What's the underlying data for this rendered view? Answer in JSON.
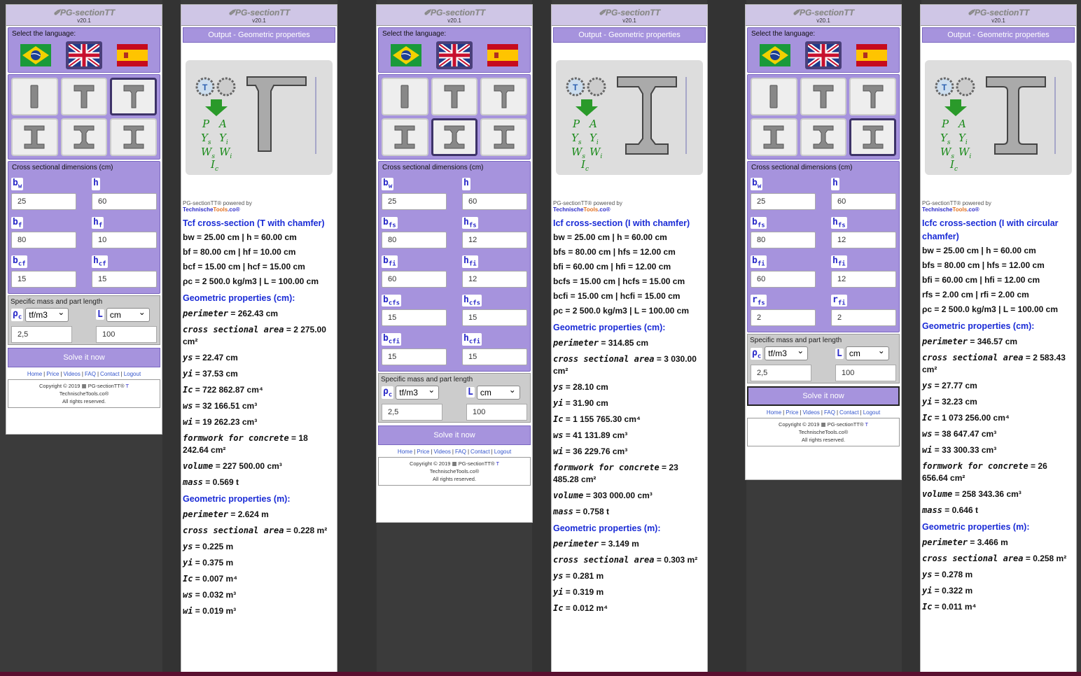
{
  "app": {
    "title": "PG-sectionTT",
    "version": "v20.1"
  },
  "ui": {
    "select_language": "Select the language:",
    "output_title": "Output - Geometric properties",
    "cross_dims": "Cross sectional dimensions (cm)",
    "mass_title": "Specific mass and part length",
    "solve": "Solve it now",
    "rho_unit": "tf/m3",
    "len_unit": "cm",
    "rho_val": "2,5",
    "len_val": "100",
    "links": [
      "Home",
      "Price",
      "Videos",
      "FAQ",
      "Contact",
      "Logout"
    ],
    "copy1": "Copyright © 2019",
    "copy_brand": "PG-sectionTT®",
    "copy2": "TechnischeTools.co®",
    "copy3": "All rights reserved.",
    "powered": "powered by",
    "pg_brand": "PG-sectionTT®",
    "tt_a": "Technische",
    "tt_b": "Tools",
    "tt_c": ".co®"
  },
  "input1": {
    "fields": [
      {
        "sym": "b",
        "sub": "w",
        "val": "25"
      },
      {
        "sym": "h",
        "sub": "",
        "val": "60"
      },
      {
        "sym": "b",
        "sub": "f",
        "val": "80"
      },
      {
        "sym": "h",
        "sub": "f",
        "val": "10"
      },
      {
        "sym": "b",
        "sub": "cf",
        "val": "15"
      },
      {
        "sym": "h",
        "sub": "cf",
        "val": "15"
      }
    ]
  },
  "input2": {
    "fields": [
      {
        "sym": "b",
        "sub": "w",
        "val": "25"
      },
      {
        "sym": "h",
        "sub": "",
        "val": "60"
      },
      {
        "sym": "b",
        "sub": "fs",
        "val": "80"
      },
      {
        "sym": "h",
        "sub": "fs",
        "val": "12"
      },
      {
        "sym": "b",
        "sub": "fi",
        "val": "60"
      },
      {
        "sym": "h",
        "sub": "fi",
        "val": "12"
      },
      {
        "sym": "b",
        "sub": "cfs",
        "val": "15"
      },
      {
        "sym": "h",
        "sub": "cfs",
        "val": "15"
      },
      {
        "sym": "b",
        "sub": "cfi",
        "val": "15"
      },
      {
        "sym": "h",
        "sub": "cfi",
        "val": "15"
      }
    ]
  },
  "input3": {
    "fields": [
      {
        "sym": "b",
        "sub": "w",
        "val": "25"
      },
      {
        "sym": "h",
        "sub": "",
        "val": "60"
      },
      {
        "sym": "b",
        "sub": "fs",
        "val": "80"
      },
      {
        "sym": "h",
        "sub": "fs",
        "val": "12"
      },
      {
        "sym": "b",
        "sub": "fi",
        "val": "60"
      },
      {
        "sym": "h",
        "sub": "fi",
        "val": "12"
      },
      {
        "sym": "r",
        "sub": "fs",
        "val": "2"
      },
      {
        "sym": "r",
        "sub": "fi",
        "val": "2"
      }
    ]
  },
  "out1": {
    "title": "Tcf cross-section (T with chamfer)",
    "lines_in": [
      "bw = 25.00 cm | h = 60.00 cm",
      "bf = 80.00 cm | hf = 10.00 cm",
      "bcf = 15.00 cm | hcf = 15.00 cm",
      "ρc = 2 500.0 kg/m3 | L = 100.00 cm"
    ],
    "cm_title": "Geometric properties (cm):",
    "cm": [
      [
        "perimeter",
        "262.43 cm"
      ],
      [
        "cross sectional area",
        "2 275.00 cm²"
      ],
      [
        "ys",
        "22.47 cm"
      ],
      [
        "yi",
        "37.53 cm"
      ],
      [
        "Ic",
        "722 862.87 cm⁴"
      ],
      [
        "ws",
        "32 166.51 cm³"
      ],
      [
        "wi",
        "19 262.23 cm³"
      ],
      [
        "formwork for concrete",
        "18 242.64 cm²"
      ],
      [
        "volume",
        "227 500.00 cm³"
      ],
      [
        "mass",
        "0.569 t"
      ]
    ],
    "m_title": "Geometric properties (m):",
    "m": [
      [
        "perimeter",
        "2.624 m"
      ],
      [
        "cross sectional area",
        "0.228 m²"
      ],
      [
        "ys",
        "0.225 m"
      ],
      [
        "yi",
        "0.375 m"
      ],
      [
        "Ic",
        "0.007 m⁴"
      ],
      [
        "ws",
        "0.032 m³"
      ],
      [
        "wi",
        "0.019 m³"
      ]
    ]
  },
  "out2": {
    "title": "Icf cross-section (I with chamfer)",
    "lines_in": [
      "bw = 25.00 cm | h = 60.00 cm",
      "bfs = 80.00 cm | hfs = 12.00 cm",
      "bfi = 60.00 cm | hfi = 12.00 cm",
      "bcfs = 15.00 cm | hcfs = 15.00 cm",
      "bcfi = 15.00 cm | hcfi = 15.00 cm",
      "ρc = 2 500.0 kg/m3 | L = 100.00 cm"
    ],
    "cm_title": "Geometric properties (cm):",
    "cm": [
      [
        "perimeter",
        "314.85 cm"
      ],
      [
        "cross sectional area",
        "3 030.00 cm²"
      ],
      [
        "ys",
        "28.10 cm"
      ],
      [
        "yi",
        "31.90 cm"
      ],
      [
        "Ic",
        "1 155 765.30 cm⁴"
      ],
      [
        "ws",
        "41 131.89 cm³"
      ],
      [
        "wi",
        "36 229.76 cm³"
      ],
      [
        "formwork for concrete",
        "23 485.28 cm²"
      ],
      [
        "volume",
        "303 000.00 cm³"
      ],
      [
        "mass",
        "0.758 t"
      ]
    ],
    "m_title": "Geometric properties (m):",
    "m": [
      [
        "perimeter",
        "3.149 m"
      ],
      [
        "cross sectional area",
        "0.303 m²"
      ],
      [
        "ys",
        "0.281 m"
      ],
      [
        "yi",
        "0.319 m"
      ],
      [
        "Ic",
        "0.012 m⁴"
      ]
    ]
  },
  "out3": {
    "title": "Icfc cross-section (I with circular chamfer)",
    "lines_in": [
      "bw = 25.00 cm | h = 60.00 cm",
      "bfs = 80.00 cm | hfs = 12.00 cm",
      "bfi = 60.00 cm | hfi = 12.00 cm",
      "rfs = 2.00 cm | rfi = 2.00 cm",
      "ρc = 2 500.0 kg/m3 | L = 100.00 cm"
    ],
    "cm_title": "Geometric properties (cm):",
    "cm": [
      [
        "perimeter",
        "346.57 cm"
      ],
      [
        "cross sectional area",
        "2 583.43 cm²"
      ],
      [
        "ys",
        "27.77 cm"
      ],
      [
        "yi",
        "32.23 cm"
      ],
      [
        "Ic",
        "1 073 256.00 cm⁴"
      ],
      [
        "ws",
        "38 647.47 cm³"
      ],
      [
        "wi",
        "33 300.33 cm³"
      ],
      [
        "formwork for concrete",
        "26 656.64 cm²"
      ],
      [
        "volume",
        "258 343.36 cm³"
      ],
      [
        "mass",
        "0.646 t"
      ]
    ],
    "m_title": "Geometric properties (m):",
    "m": [
      [
        "perimeter",
        "3.466 m"
      ],
      [
        "cross sectional area",
        "0.258 m²"
      ],
      [
        "ys",
        "0.278 m"
      ],
      [
        "yi",
        "0.322 m"
      ],
      [
        "Ic",
        "0.011 m⁴"
      ]
    ]
  },
  "figure_labels": {
    "P": "P",
    "A": "A",
    "Ys": "Ys",
    "Yi": "Yi",
    "Ws": "Ws",
    "Wi": "Wi",
    "Ic": "Ic"
  }
}
